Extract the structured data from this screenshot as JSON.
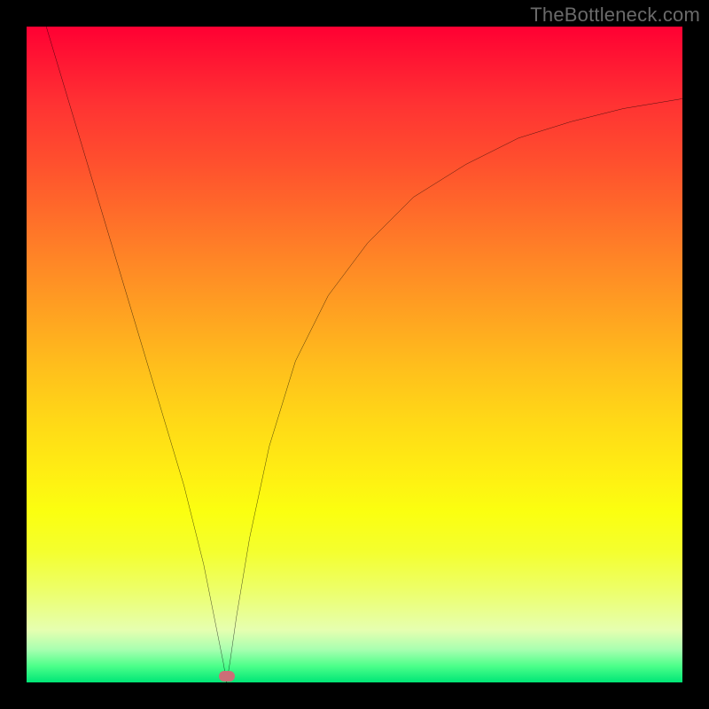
{
  "watermark": "TheBottleneck.com",
  "marker": {
    "x_pct": 30.5,
    "y_pct": 99.0
  },
  "chart_data": {
    "type": "line",
    "title": "",
    "xlabel": "",
    "ylabel": "",
    "xlim": [
      0,
      100
    ],
    "ylim": [
      0,
      100
    ],
    "grid": false,
    "legend": false,
    "series": [
      {
        "name": "curve",
        "x": [
          3,
          6,
          9,
          12,
          15,
          18,
          21,
          24,
          27,
          29,
          30,
          30.5,
          31,
          32,
          34,
          37,
          41,
          46,
          52,
          59,
          67,
          75,
          83,
          91,
          100
        ],
        "y": [
          100,
          90,
          80,
          70,
          60,
          50,
          40,
          30,
          18,
          8,
          3,
          0,
          3,
          10,
          22,
          36,
          49,
          59,
          67,
          74,
          79,
          83,
          85.5,
          87.5,
          89
        ]
      }
    ],
    "background_gradient_stops": [
      {
        "pct": 0,
        "color": "#ff0033"
      },
      {
        "pct": 12,
        "color": "#ff3333"
      },
      {
        "pct": 28,
        "color": "#ff6a2a"
      },
      {
        "pct": 44,
        "color": "#ffa321"
      },
      {
        "pct": 60,
        "color": "#ffd817"
      },
      {
        "pct": 74,
        "color": "#fbff10"
      },
      {
        "pct": 86,
        "color": "#edff6a"
      },
      {
        "pct": 95,
        "color": "#a8ffb0"
      },
      {
        "pct": 100,
        "color": "#00e676"
      }
    ],
    "annotations": [
      {
        "type": "marker",
        "x": 30.5,
        "y": 0,
        "shape": "pill",
        "color": "#cc6e77"
      }
    ]
  }
}
